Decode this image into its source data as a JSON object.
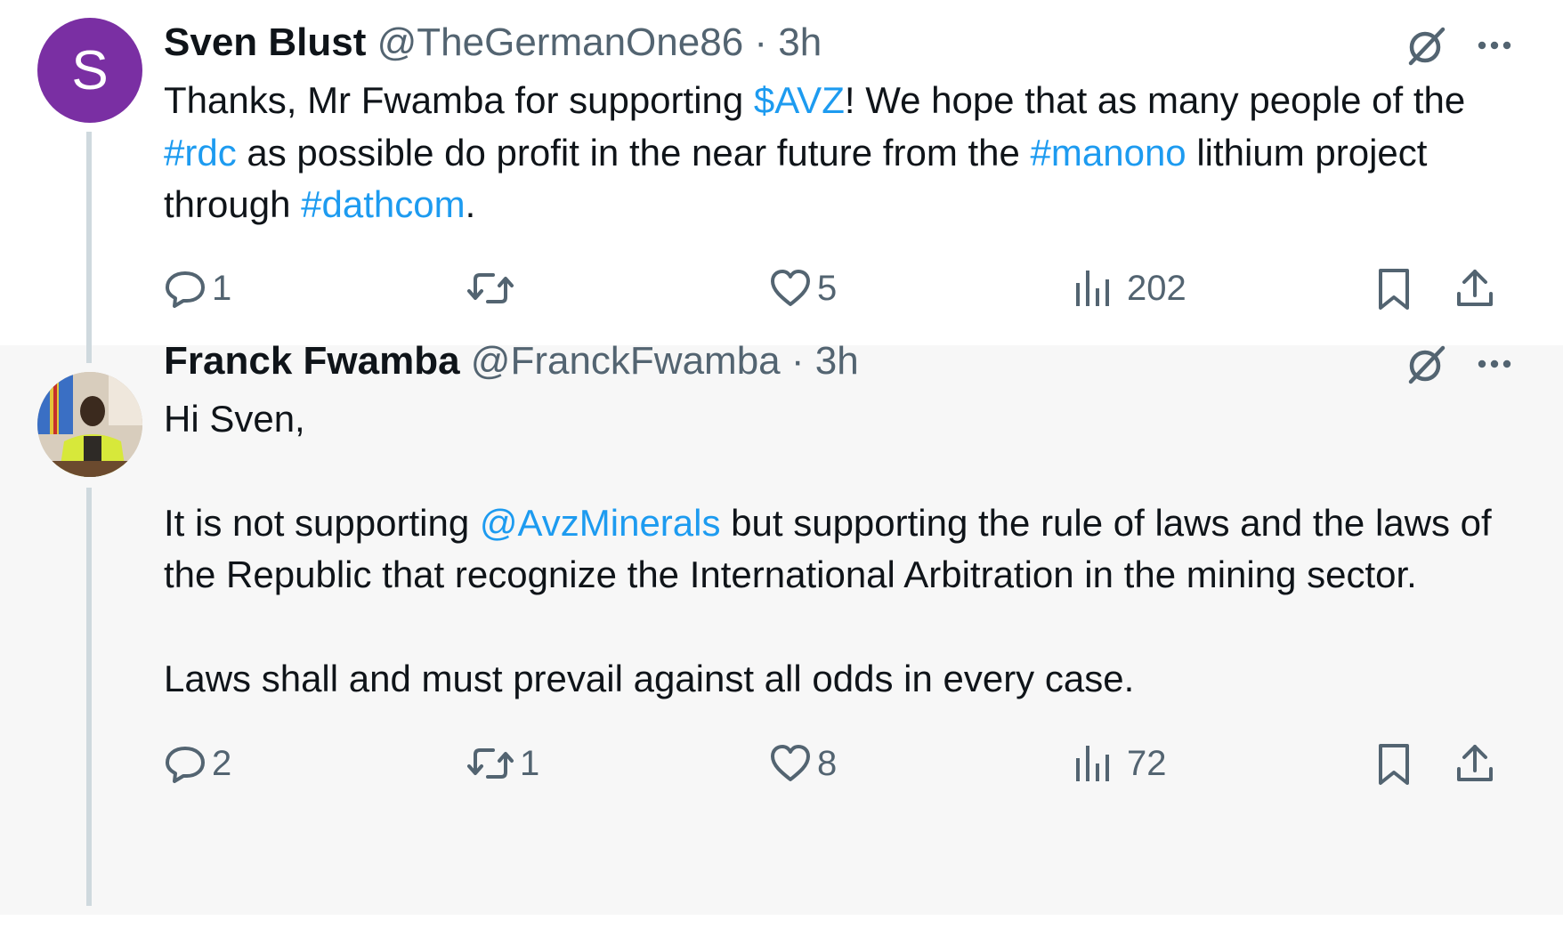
{
  "tweets": [
    {
      "avatar_letter": "S",
      "name": "Sven Blust",
      "handle": "@TheGermanOne86",
      "separator": "·",
      "time": "3h",
      "text": {
        "p1": "Thanks,  Mr Fwamba for supporting ",
        "l1": "$AVZ",
        "p2": "! We hope that as many people of the ",
        "l2": "#rdc",
        "p3": " as possible do profit in the near future from the ",
        "l3": "#manono",
        "p4": " lithium project through ",
        "l4": "#dathcom",
        "p5": "."
      },
      "replies": "1",
      "reposts": "",
      "likes": "5",
      "views": "202"
    },
    {
      "name": "Franck Fwamba",
      "handle": "@FranckFwamba",
      "separator": "·",
      "time": "3h",
      "text": {
        "line1": "Hi Sven,",
        "p1": "It is not supporting ",
        "l1": "@AvzMinerals",
        "p2": " but supporting the rule of laws and the laws of the Republic that recognize the International Arbitration in the mining sector.",
        "line3": "Laws shall and must prevail against all odds in every case."
      },
      "replies": "2",
      "reposts": "1",
      "likes": "8",
      "views": "72"
    }
  ],
  "colors": {
    "link": "#1d9bf0",
    "muted": "#536471",
    "avatar_bg": "#7a2fa3",
    "thread_line": "#cfd9de"
  },
  "icons": [
    "grok-icon",
    "more-icon",
    "reply-icon",
    "repost-icon",
    "like-icon",
    "views-icon",
    "bookmark-icon",
    "share-icon"
  ]
}
